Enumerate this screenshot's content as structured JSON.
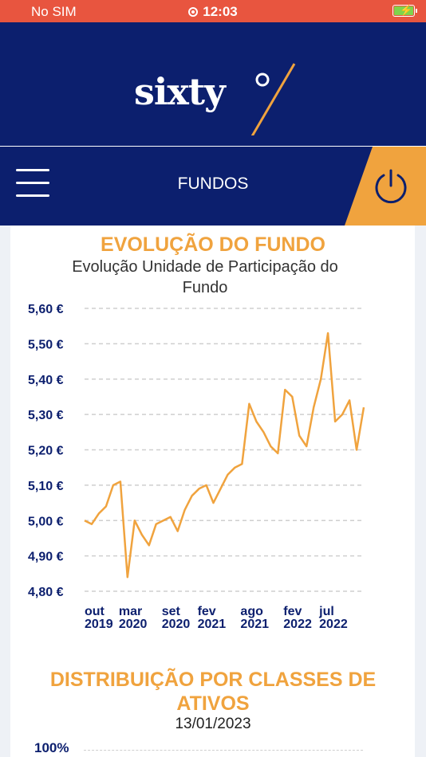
{
  "status_bar": {
    "carrier": "No SIM",
    "time": "12:03",
    "colors": {
      "background": "#e8553f",
      "battery": "#7fd34b"
    }
  },
  "brand": {
    "logo_text": "sixty",
    "logo_mark": "0",
    "colors": {
      "background": "#0c1f6e",
      "accent": "#f0a33e"
    }
  },
  "nav": {
    "title": "FUNDOS",
    "menu_icon": "hamburger-menu-icon",
    "power_icon": "power-icon"
  },
  "evolution_chart": {
    "title": "EVOLUÇÃO DO FUNDO",
    "subtitle": "Evolução Unidade de Participação do Fundo"
  },
  "chart_data": {
    "type": "line",
    "title": "EVOLUÇÃO DO FUNDO",
    "subtitle": "Evolução Unidade de Participação do Fundo",
    "color": "#f0a33e",
    "y_ticks": [
      "5,60 €",
      "5,50 €",
      "5,40 €",
      "5,30 €",
      "5,20 €",
      "5,10 €",
      "5,00 €",
      "4,90 €",
      "4,80 €"
    ],
    "y_tick_values": [
      5.6,
      5.5,
      5.4,
      5.3,
      5.2,
      5.1,
      5.0,
      4.9,
      4.8
    ],
    "ylim": [
      4.8,
      5.6
    ],
    "grid": true,
    "x_ticks": [
      {
        "date": "2019-10",
        "line1": "out",
        "line2": "2019"
      },
      {
        "date": "2020-03",
        "line1": "mar",
        "line2": "2020"
      },
      {
        "date": "2020-09",
        "line1": "set",
        "line2": "2020"
      },
      {
        "date": "2021-02",
        "line1": "fev",
        "line2": "2021"
      },
      {
        "date": "2021-08",
        "line1": "ago",
        "line2": "2021"
      },
      {
        "date": "2022-02",
        "line1": "fev",
        "line2": "2022"
      },
      {
        "date": "2022-07",
        "line1": "jul",
        "line2": "2022"
      }
    ],
    "x": [
      "2019-10",
      "2019-11",
      "2019-12",
      "2020-01",
      "2020-02",
      "2020-03",
      "2020-04",
      "2020-05",
      "2020-06",
      "2020-07",
      "2020-08",
      "2020-09",
      "2020-10",
      "2020-11",
      "2020-12",
      "2021-01",
      "2021-02",
      "2021-03",
      "2021-04",
      "2021-05",
      "2021-06",
      "2021-07",
      "2021-08",
      "2021-09",
      "2021-10",
      "2021-11",
      "2021-12",
      "2022-01",
      "2022-02",
      "2022-03",
      "2022-04",
      "2022-05",
      "2022-06",
      "2022-07",
      "2022-08",
      "2022-09",
      "2022-10",
      "2022-11",
      "2022-12",
      "2023-01"
    ],
    "series": [
      {
        "values": [
          5.0,
          4.99,
          5.02,
          5.04,
          5.1,
          5.11,
          4.84,
          5.0,
          4.96,
          4.93,
          4.99,
          5.0,
          5.01,
          4.97,
          5.03,
          5.07,
          5.09,
          5.1,
          5.05,
          5.09,
          5.13,
          5.15,
          5.16,
          5.33,
          5.28,
          5.25,
          5.21,
          5.19,
          5.37,
          5.35,
          5.24,
          5.21,
          5.32,
          5.4,
          5.53,
          5.28,
          5.3,
          5.34,
          5.2,
          5.32
        ]
      }
    ]
  },
  "distribution_chart": {
    "title": "DISTRIBUIÇÃO POR CLASSES DE ATIVOS",
    "date": "13/01/2023",
    "y_tick_top": "100%"
  }
}
